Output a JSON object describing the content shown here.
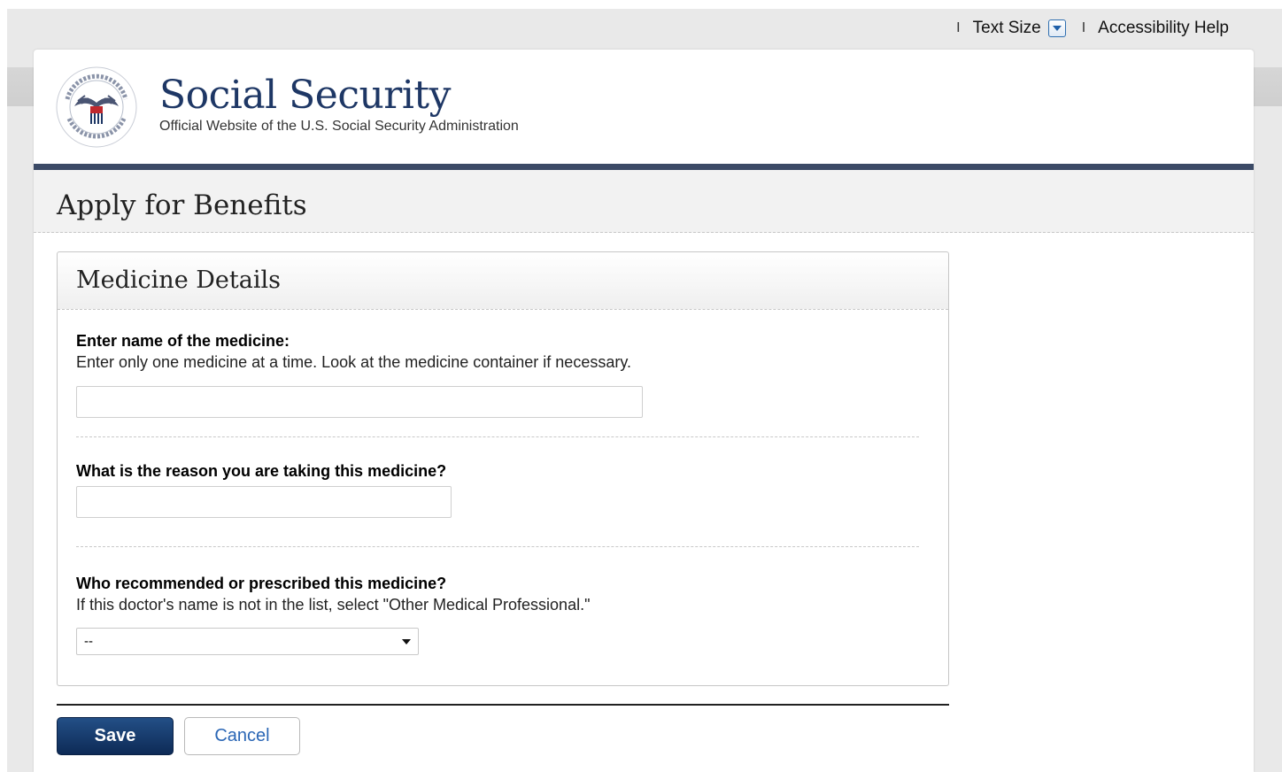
{
  "utility": {
    "separator": "I",
    "text_size_label": "Text Size",
    "accessibility_label": "Accessibility Help"
  },
  "brand": {
    "title": "Social Security",
    "subtitle": "Official Website of the U.S. Social Security Administration",
    "seal_text": "SOCIAL SECURITY ADMINISTRATION USA"
  },
  "page": {
    "title": "Apply for Benefits"
  },
  "panel": {
    "title": "Medicine Details",
    "fields": [
      {
        "label": "Enter name of the medicine:",
        "hint": "Enter only one medicine at a time. Look at the medicine container if necessary.",
        "value": ""
      },
      {
        "label": "What is the reason you are taking this medicine?",
        "value": ""
      },
      {
        "label": "Who recommended or prescribed this medicine?",
        "hint": "If this doctor's name is not in the list, select \"Other Medical Professional.\"",
        "selected": "--"
      }
    ]
  },
  "actions": {
    "save_label": "Save",
    "cancel_label": "Cancel"
  },
  "colors": {
    "brand_navy": "#1e3765",
    "rule": "#3b4a66",
    "save_button": "#0d2a56",
    "link_blue": "#2a66b5"
  }
}
